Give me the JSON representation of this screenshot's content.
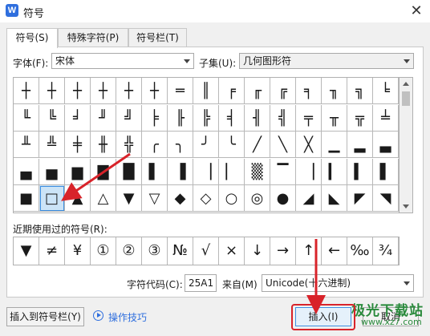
{
  "window": {
    "title": "符号",
    "app_icon_letter": "W",
    "close_glyph": "✕"
  },
  "tabs": [
    "符号(S)",
    "特殊字符(P)",
    "符号栏(T)"
  ],
  "font": {
    "label": "字体(F):",
    "value": "宋体"
  },
  "subset": {
    "label": "子集(U):",
    "value": "几何图形符"
  },
  "grid_rows": [
    [
      "┼",
      "┼",
      "┼",
      "┼",
      "┼",
      "┼",
      "═",
      "║",
      "╒",
      "╓",
      "╔",
      "╕",
      "╖",
      "╗",
      "╘"
    ],
    [
      "╙",
      "╚",
      "╛",
      "╜",
      "╝",
      "╞",
      "╟",
      "╠",
      "╡",
      "╢",
      "╣",
      "╤",
      "╥",
      "╦",
      "╧"
    ],
    [
      "╨",
      "╩",
      "╪",
      "╫",
      "╬",
      "╭",
      "╮",
      "╯",
      "╰",
      "╱",
      "╲",
      "╳",
      "▁",
      "▂",
      "▃"
    ],
    [
      "▄",
      "▅",
      "▆",
      "▇",
      "█",
      "▌",
      "▐",
      "▕",
      "▏",
      "▒",
      "▔",
      "▕",
      "▎",
      "▍",
      "▌"
    ],
    [
      "■",
      "□",
      "▲",
      "△",
      "▼",
      "▽",
      "◆",
      "◇",
      "○",
      "◎",
      "●",
      "◢",
      "◣",
      "◤",
      "◥"
    ]
  ],
  "selected_symbol": "□",
  "recent": {
    "label": "近期使用过的符号(R):",
    "symbols": [
      "▼",
      "≠",
      "¥",
      "①",
      "②",
      "③",
      "№",
      "√",
      "×",
      "↓",
      "→",
      "↑",
      "←",
      "‰",
      "¾"
    ]
  },
  "char_code": {
    "label": "字符代码(C):",
    "value": "25A1"
  },
  "from": {
    "label": "来自(M)",
    "value": "Unicode(十六进制)"
  },
  "buttons": {
    "insert_to_bar": "插入到符号栏(Y)",
    "tips": "操作技巧",
    "insert": "插入(I)",
    "cancel": "取消"
  },
  "watermark": {
    "main": "极光下载站",
    "sub": "www.xz7.com"
  },
  "colors": {
    "accent": "#2f6fde",
    "annotation_arrow": "#d8232a",
    "selection": "#cce4f7"
  }
}
